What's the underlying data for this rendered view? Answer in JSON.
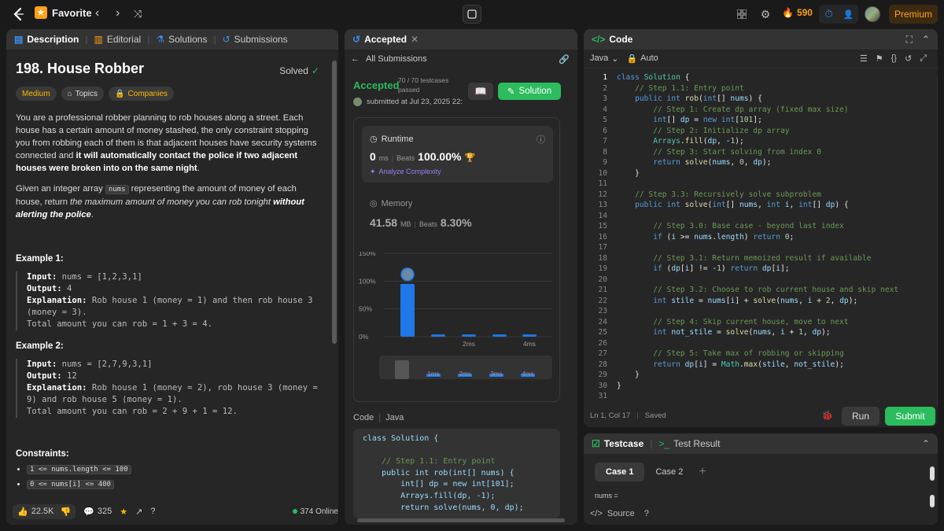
{
  "topbar": {
    "favorite_label": "Favorite",
    "streak_count": "590",
    "premium_label": "Premium"
  },
  "left_panel": {
    "tabs": [
      "Description",
      "Editorial",
      "Solutions",
      "Submissions"
    ],
    "problem_title": "198. House Robber",
    "solved_label": "Solved",
    "tags": [
      "Medium",
      "Topics",
      "Companies"
    ],
    "para1_a": "You are a professional robber planning to rob houses along a street. Each house has a certain amount of money stashed, the only constraint stopping you from robbing each of them is that adjacent houses have security systems connected and ",
    "para1_b": "it will automatically contact the police if two adjacent houses were broken into on the same night",
    "para1_c": ".",
    "para2_a": "Given an integer array ",
    "para2_code": "nums",
    "para2_b": " representing the amount of money of each house, return ",
    "para2_i": "the maximum amount of money you can rob tonight ",
    "para2_bi": "without alerting the police",
    "para2_c": ".",
    "example1": {
      "heading": "Example 1:",
      "input_label": "Input:",
      "input": " nums = [1,2,3,1]",
      "output_label": "Output:",
      "output": " 4",
      "expl_label": "Explanation:",
      "expl": " Rob house 1 (money = 1) and then rob house 3 (money = 3).",
      "expl2": "Total amount you can rob = 1 + 3 = 4."
    },
    "example2": {
      "heading": "Example 2:",
      "input_label": "Input:",
      "input": " nums = [2,7,9,3,1]",
      "output_label": "Output:",
      "output": " 12",
      "expl_label": "Explanation:",
      "expl": " Rob house 1 (money = 2), rob house 3 (money = 9) and rob house 5 (money = 1).",
      "expl2": "Total amount you can rob = 2 + 9 + 1 = 12."
    },
    "constraints_heading": "Constraints:",
    "constraints": [
      "1 <= nums.length <= 100",
      "0 <= nums[i] <= 400"
    ],
    "footer": {
      "likes": "22.5K",
      "comments": "325",
      "online": "374 Online"
    }
  },
  "mid_panel": {
    "tab_label": "Accepted",
    "back_label": "All Submissions",
    "status": "Accepted",
    "testcases": "70 / 70 testcases",
    "passed": "passed",
    "submitted": "submitted at Jul 23, 2025 22:",
    "solution_btn": "Solution",
    "runtime": {
      "label": "Runtime",
      "value": "0",
      "unit": "ms",
      "beats_label": "Beats",
      "beats": "100.00%",
      "analyze": "Analyze Complexity"
    },
    "memory": {
      "label": "Memory",
      "value": "41.58",
      "unit": "MB",
      "beats_label": "Beats",
      "beats": "8.30%"
    },
    "code_label": "Code",
    "lang_label": "Java",
    "code_lines": [
      "class Solution {",
      "",
      "    // Step 1.1: Entry point",
      "    public int rob(int[] nums) {",
      "        int[] dp = new int[101];",
      "        Arrays.fill(dp, -1);",
      "        return solve(nums, 0, dp);"
    ]
  },
  "chart_data": {
    "type": "bar",
    "y_ticks": [
      "150%",
      "100%",
      "50%",
      "0%"
    ],
    "ylim": [
      0,
      150
    ],
    "x_tick_labels": [
      "2ms",
      "4ms"
    ],
    "values": [
      95,
      4,
      4,
      4,
      4
    ],
    "minimap_labels": [
      "1ms",
      "2ms",
      "3ms",
      "4ms"
    ]
  },
  "right_panel": {
    "tab_label": "Code",
    "lang": "Java",
    "auto": "Auto",
    "status_pos": "Ln 1, Col 17",
    "status_saved": "Saved",
    "run_label": "Run",
    "submit_label": "Submit",
    "bottom_tabs": [
      "Testcase",
      "Test Result"
    ],
    "cases": [
      "Case 1",
      "Case 2"
    ],
    "nums_label": "nums =",
    "source_label": "Source"
  },
  "colors": {
    "accent_green": "#2cbb5d",
    "orange": "#ffa116",
    "bg": "#1a1a1a",
    "panel": "#262626"
  }
}
